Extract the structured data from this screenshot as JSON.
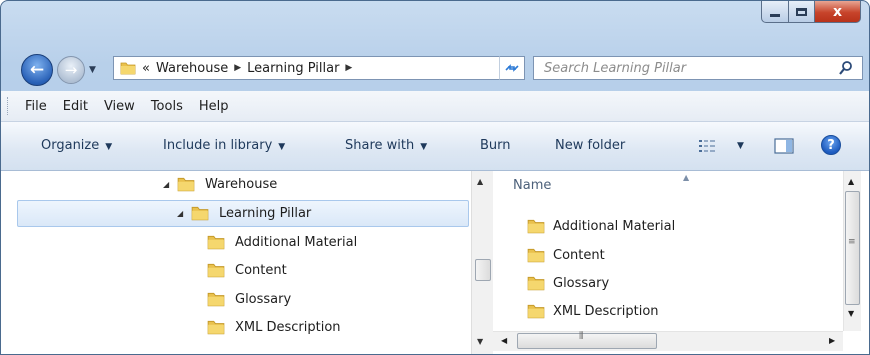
{
  "window": {
    "close_glyph": "x"
  },
  "nav": {
    "back_glyph": "←",
    "forward_glyph": "→",
    "address_prefix": "«",
    "breadcrumbs": [
      "Warehouse",
      "Learning Pillar"
    ],
    "search_placeholder": "Search Learning Pillar"
  },
  "menu": [
    "File",
    "Edit",
    "View",
    "Tools",
    "Help"
  ],
  "commands": {
    "organize": "Organize",
    "include_in_library": "Include in library",
    "share_with": "Share with",
    "burn": "Burn",
    "new_folder": "New folder",
    "help_glyph": "?"
  },
  "tree": [
    {
      "label": "Warehouse",
      "expanded": true
    },
    {
      "label": "Learning Pillar",
      "expanded": true,
      "selected": true
    },
    {
      "label": "Additional Material"
    },
    {
      "label": "Content"
    },
    {
      "label": "Glossary"
    },
    {
      "label": "XML Description"
    }
  ],
  "files": {
    "column_name": "Name",
    "items": [
      "Additional Material",
      "Content",
      "Glossary",
      "XML Description"
    ]
  },
  "colors": {
    "folder": "#e9c14d",
    "selection": "#dae8f8",
    "accent": "#2a62b8"
  }
}
